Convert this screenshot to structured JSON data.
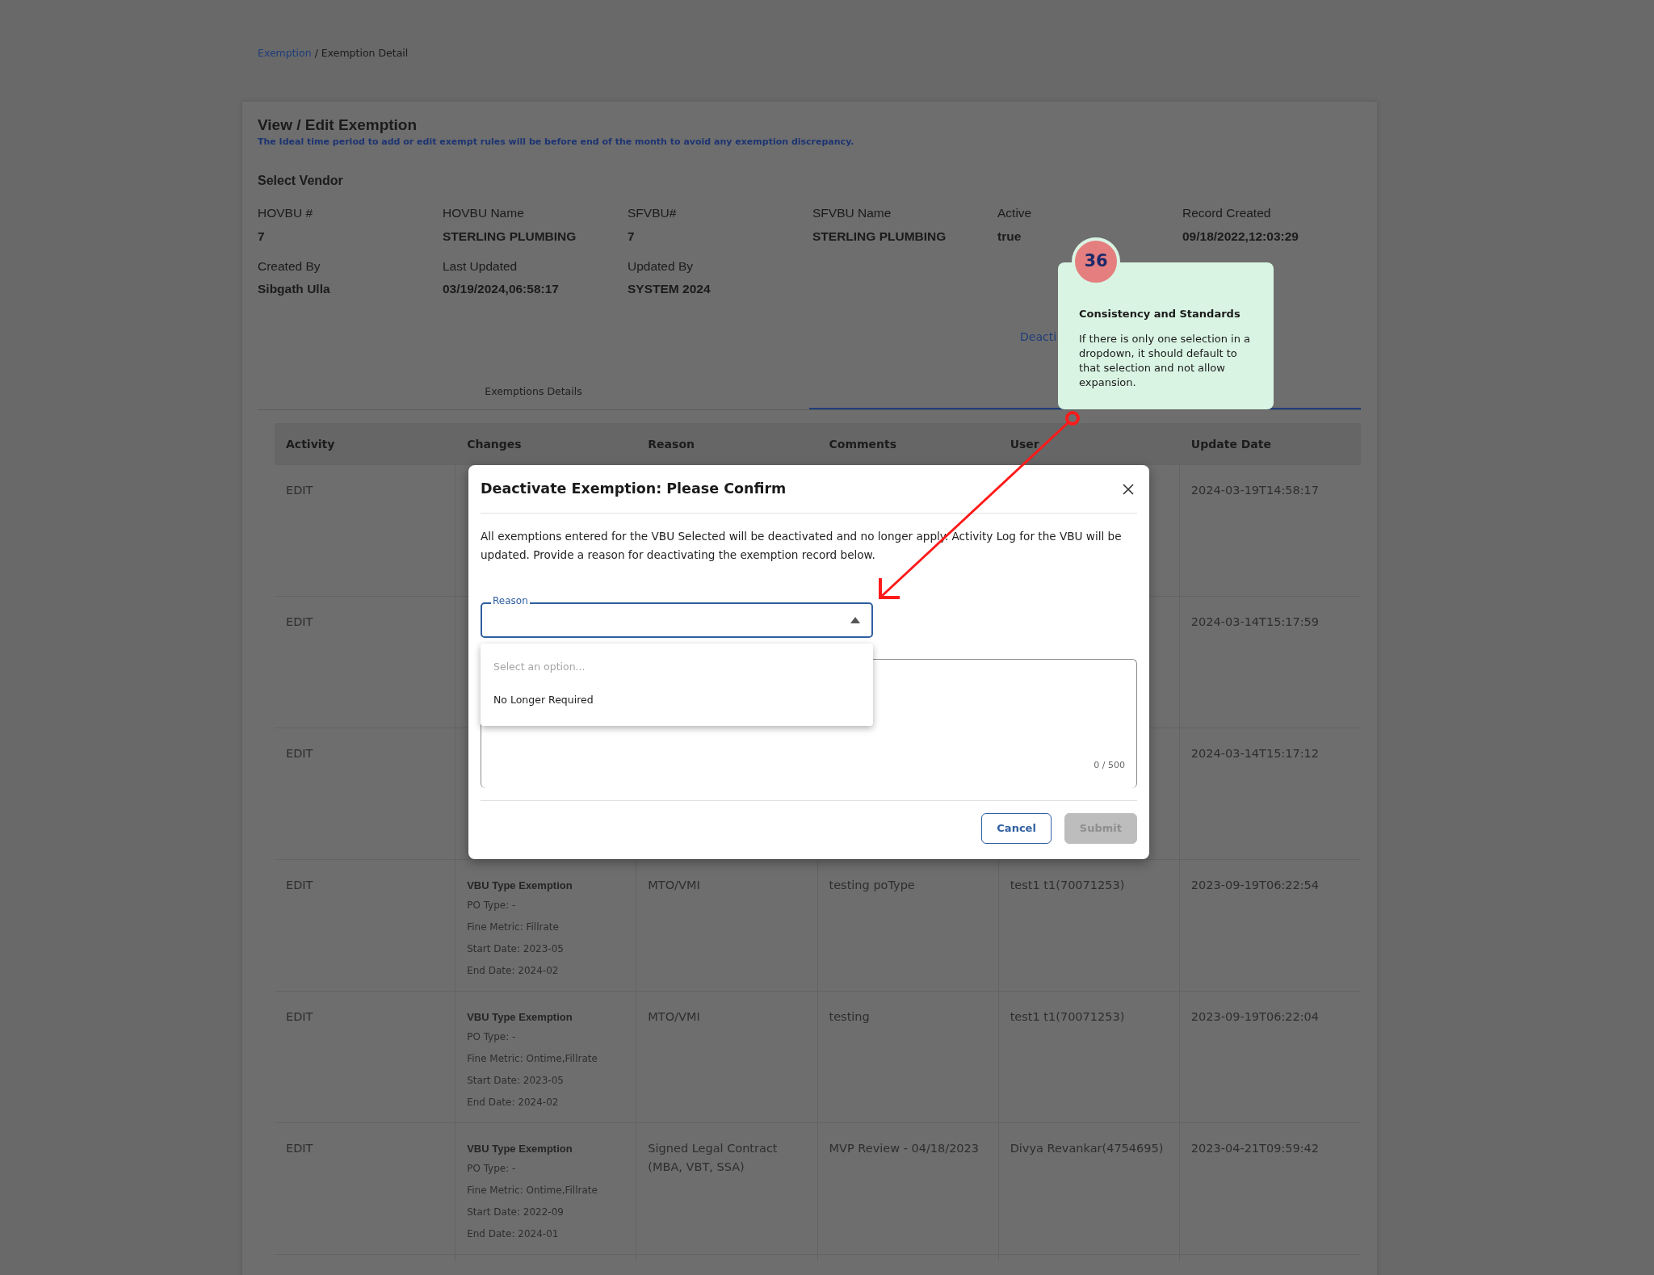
{
  "breadcrumb": {
    "parent": "Exemption",
    "separator": "/",
    "current": "Exemption Detail"
  },
  "page_title": "View / Edit Exemption",
  "notice": "The Ideal time period to add or edit exempt rules will be before end of the month to avoid any exemption discrepancy.",
  "section_title": "Select Vendor",
  "fields": [
    {
      "label": "HOVBU #",
      "value": "7"
    },
    {
      "label": "HOVBU Name",
      "value": "STERLING PLUMBING"
    },
    {
      "label": "SFVBU#",
      "value": "7"
    },
    {
      "label": "SFVBU Name",
      "value": "STERLING PLUMBING"
    },
    {
      "label": "Active",
      "value": "true"
    },
    {
      "label": "Record Created",
      "value": "09/18/2022,12:03:29"
    },
    {
      "label": "Created By",
      "value": "Sibgath Ulla"
    },
    {
      "label": "Last Updated",
      "value": "03/19/2024,06:58:17"
    },
    {
      "label": "Updated By",
      "value": "SYSTEM 2024"
    }
  ],
  "deactivate_button": {
    "label": "Deacti"
  },
  "tabs": [
    {
      "label": "Exemptions Details",
      "selected": false
    },
    {
      "selected": true
    }
  ],
  "table": {
    "columns": [
      "Activity",
      "Changes",
      "Reason",
      "Comments",
      "User",
      "Update Date"
    ],
    "rows": [
      {
        "activity": "EDIT",
        "update_date": "2024-03-19T14:58:17"
      },
      {
        "activity": "EDIT",
        "update_date": "2024-03-14T15:17:59"
      },
      {
        "activity": "EDIT",
        "update_date": "2024-03-14T15:17:12"
      },
      {
        "activity": "EDIT",
        "changes": {
          "title": "VBU Type Exemption",
          "lines": [
            "PO Type: -",
            "Fine Metric: Fillrate",
            "Start Date: 2023-05",
            "End Date: 2024-02"
          ]
        },
        "reason": "MTO/VMI",
        "comments": "testing poType",
        "user": "test1 t1(70071253)",
        "update_date": "2023-09-19T06:22:54"
      },
      {
        "activity": "EDIT",
        "changes": {
          "title": "VBU Type Exemption",
          "lines": [
            "PO Type: -",
            "Fine Metric: Ontime,Fillrate",
            "Start Date: 2023-05",
            "End Date: 2024-02"
          ]
        },
        "reason": "MTO/VMI",
        "comments": "testing",
        "user": "test1 t1(70071253)",
        "update_date": "2023-09-19T06:22:04"
      },
      {
        "activity": "EDIT",
        "changes": {
          "title": "VBU Type Exemption",
          "lines": [
            "PO Type: -",
            "Fine Metric: Ontime,Fillrate",
            "Start Date: 2022-09",
            "End Date: 2024-01"
          ]
        },
        "reason": "Signed Legal Contract (MBA, VBT, SSA)",
        "comments": "MVP Review - 04/18/2023",
        "user": "Divya Revankar(4754695)",
        "update_date": "2023-04-21T09:59:42"
      }
    ]
  },
  "modal": {
    "title": "Deactivate Exemption: Please Confirm",
    "message": "All exemptions entered for the VBU Selected will be deactivated and no longer apply. Activity Log for the VBU will be updated. Provide a reason for deactivating the exemption record below.",
    "reason_field": {
      "label": "Reason",
      "expanded": true
    },
    "options": [
      {
        "kind": "placeholder",
        "label": "Select an option..."
      },
      {
        "kind": "option",
        "label": "No Longer Required"
      }
    ],
    "counter": "0 / 500",
    "buttons": [
      {
        "label": "Cancel",
        "disabled": false
      },
      {
        "label": "Submit",
        "disabled": true
      }
    ]
  },
  "annotation": {
    "number": "36",
    "title": "Consistency and Standards",
    "text": "If there is only one selection in a dropdown, it should default to that selection and not allow expansion."
  }
}
